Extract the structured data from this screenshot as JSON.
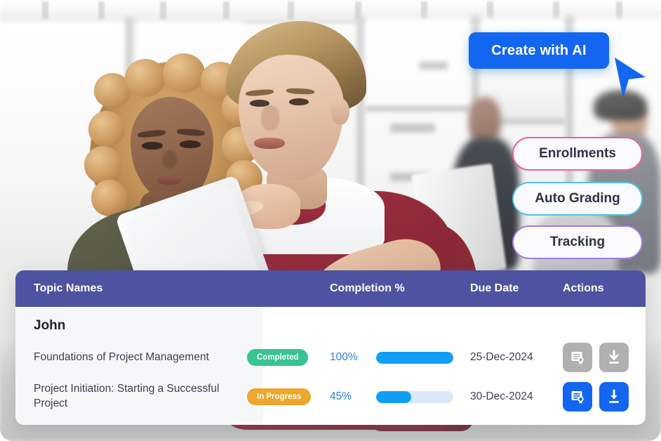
{
  "cta": {
    "label": "Create with AI",
    "color": "#1366f0",
    "cursor_icon": "mouse-cursor-arrow-icon"
  },
  "feature_pills": [
    {
      "label": "Enrollments",
      "border_color": "#e8649f"
    },
    {
      "label": "Auto Grading",
      "border_color": "#4fc3e8"
    },
    {
      "label": "Tracking",
      "border_color": "#a779e0"
    }
  ],
  "table": {
    "header_color": "#4d53a0",
    "columns": {
      "topic": "Topic Names",
      "completion": "Completion %",
      "due_date": "Due Date",
      "actions": "Actions"
    },
    "group_label": "John",
    "rows": [
      {
        "topic": "Foundations of Project Management",
        "status": "Completed",
        "status_kind": "completed",
        "status_color": "#38c491",
        "percent_label": "100%",
        "percent_value": 100,
        "due_date": "25-Dec-2024",
        "actions_enabled": false,
        "action_icons": [
          "certificate-icon",
          "download-icon"
        ]
      },
      {
        "topic": "Project Initiation: Starting a Successful Project",
        "status": "In Progress",
        "status_kind": "inprogress",
        "status_color": "#eda72c",
        "percent_label": "45%",
        "percent_value": 45,
        "due_date": "30-Dec-2024",
        "actions_enabled": true,
        "action_icons": [
          "certificate-icon",
          "download-icon"
        ]
      }
    ]
  },
  "photo": {
    "description": "Two colleagues reviewing a tablet in a bright modern office"
  }
}
